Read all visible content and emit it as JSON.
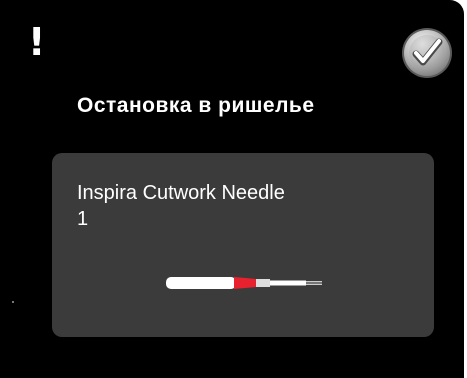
{
  "dialog": {
    "alert_symbol": "!",
    "title": "Остановка в ришелье",
    "confirm_icon": "checkmark-icon",
    "colors": {
      "background": "#000000",
      "card": "#3b3b3b",
      "text": "#ffffff",
      "needle_accent": "#e8212f"
    }
  },
  "needle": {
    "name": "Inspira Cutwork Needle",
    "number": "1"
  }
}
